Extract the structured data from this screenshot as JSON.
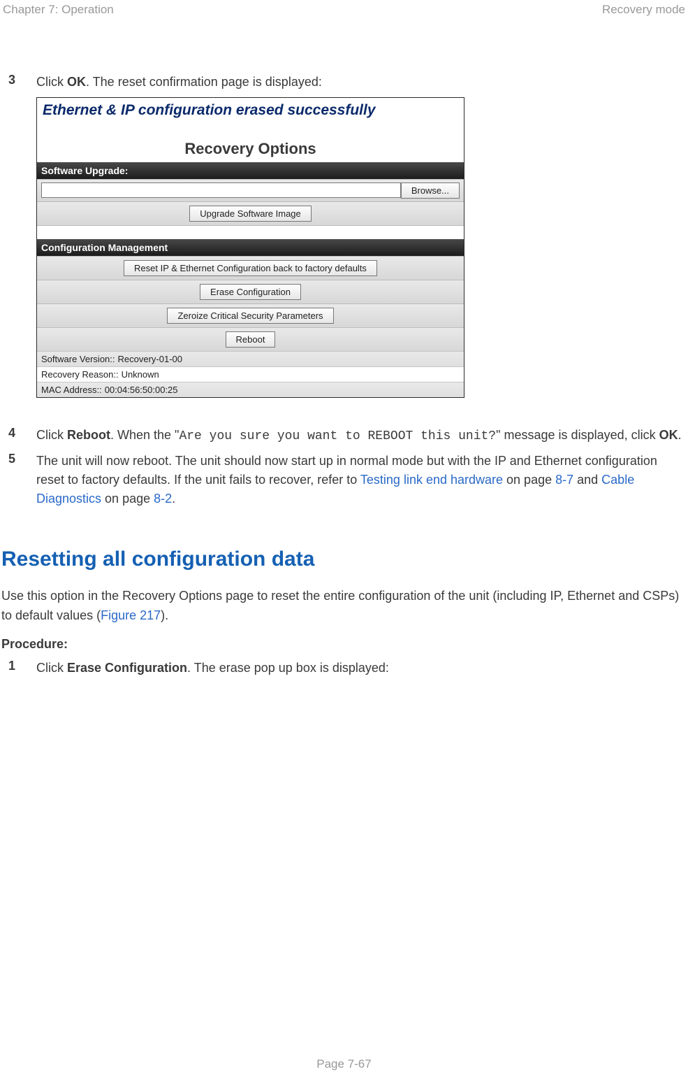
{
  "header": {
    "left": "Chapter 7:  Operation",
    "right": "Recovery mode"
  },
  "footer": {
    "page": "Page 7-67"
  },
  "steps": {
    "s3": {
      "num": "3",
      "pre": "Click ",
      "bold": "OK",
      "post": ". The reset confirmation page is displayed:"
    },
    "s4": {
      "num": "4",
      "t1": "Click ",
      "b1": "Reboot",
      "t2": ". When the \"",
      "mono": "Are you sure you want to REBOOT this unit?",
      "t3": "\" message is displayed, click ",
      "b2": "OK",
      "t4": "."
    },
    "s5": {
      "num": "5",
      "t1": "The unit will now reboot. The unit should now start up in normal mode but with the IP and Ethernet configuration reset to factory defaults. If the unit fails to recover, refer to ",
      "l1": "Testing link end hardware",
      "t2": " on page ",
      "l2": "8-7",
      "t3": " and ",
      "l3": "Cable Diagnostics",
      "t4": " on page ",
      "l4": "8-2",
      "t5": "."
    },
    "p1": {
      "num": "1",
      "pre": "Click ",
      "bold": "Erase Configuration",
      "post": ". The erase pop up box is displayed:"
    }
  },
  "screenshot": {
    "title": "Ethernet & IP configuration erased successfully",
    "subtitle": "Recovery Options",
    "section_upgrade": "Software Upgrade:",
    "browse": "Browse...",
    "upgrade_btn": "Upgrade Software Image",
    "section_config": "Configuration Management",
    "reset_btn": "Reset IP & Ethernet Configuration back to factory defaults",
    "erase_btn": "Erase Configuration",
    "zero_btn": "Zeroize Critical Security Parameters",
    "reboot_btn": "Reboot",
    "sw_label": "Software Version::",
    "sw_val": "Recovery-01-00",
    "rr_label": "Recovery Reason::",
    "rr_val": "Unknown",
    "mac_label": "MAC Address::",
    "mac_val": "00:04:56:50:00:25"
  },
  "section": {
    "heading": "Resetting all configuration data",
    "p1a": "Use this option in the Recovery Options page to reset the entire configuration of the unit (including IP, Ethernet and CSPs) to default values (",
    "p1link": "Figure 217",
    "p1b": ").",
    "procedure": "Procedure:"
  }
}
